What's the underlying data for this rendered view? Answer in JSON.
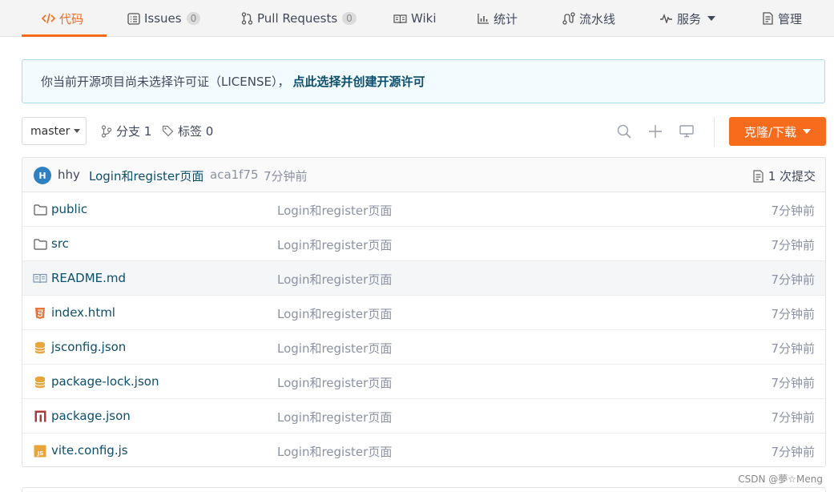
{
  "tabs": [
    {
      "label": "代码",
      "icon": "code-icon",
      "active": true
    },
    {
      "label": "Issues",
      "icon": "issues-icon",
      "count": "0"
    },
    {
      "label": "Pull Requests",
      "icon": "pull-request-icon",
      "count": "0"
    },
    {
      "label": "Wiki",
      "icon": "book-icon"
    },
    {
      "label": "统计",
      "icon": "bar-chart-icon"
    },
    {
      "label": "流水线",
      "icon": "pipeline-icon"
    },
    {
      "label": "服务",
      "icon": "pulse-icon",
      "has_dropdown": true
    },
    {
      "label": "管理",
      "icon": "manage-icon"
    }
  ],
  "notice": {
    "text": "你当前开源项目尚未选择许可证（LICENSE），",
    "link": "点此选择并创建开源许可"
  },
  "toolbar": {
    "branch": "master",
    "branches_label": "分支 1",
    "tags_label": "标签 0",
    "clone_label": "克隆/下载"
  },
  "last_commit": {
    "avatar_letter": "H",
    "user": "hhy",
    "message": "Login和register页面",
    "hash": "aca1f75",
    "time": "7分钟前",
    "commit_count": "1 次提交"
  },
  "files": [
    {
      "name": "public",
      "type": "folder",
      "message": "Login和register页面",
      "time": "7分钟前"
    },
    {
      "name": "src",
      "type": "folder",
      "message": "Login和register页面",
      "time": "7分钟前"
    },
    {
      "name": "README.md",
      "type": "readme",
      "message": "Login和register页面",
      "time": "7分钟前",
      "highlighted": true
    },
    {
      "name": "index.html",
      "type": "html",
      "message": "Login和register页面",
      "time": "7分钟前"
    },
    {
      "name": "jsconfig.json",
      "type": "json",
      "message": "Login和register页面",
      "time": "7分钟前"
    },
    {
      "name": "package-lock.json",
      "type": "json",
      "message": "Login和register页面",
      "time": "7分钟前"
    },
    {
      "name": "package.json",
      "type": "npm",
      "message": "Login和register页面",
      "time": "7分钟前"
    },
    {
      "name": "vite.config.js",
      "type": "js",
      "message": "Login和register页面",
      "time": "7分钟前"
    }
  ],
  "watermark": "CSDN @夢☆Meng",
  "colors": {
    "accent": "#f76b1c",
    "link": "#0b4f6c",
    "muted": "#8c92a4",
    "notice_border": "#a9dde5"
  }
}
